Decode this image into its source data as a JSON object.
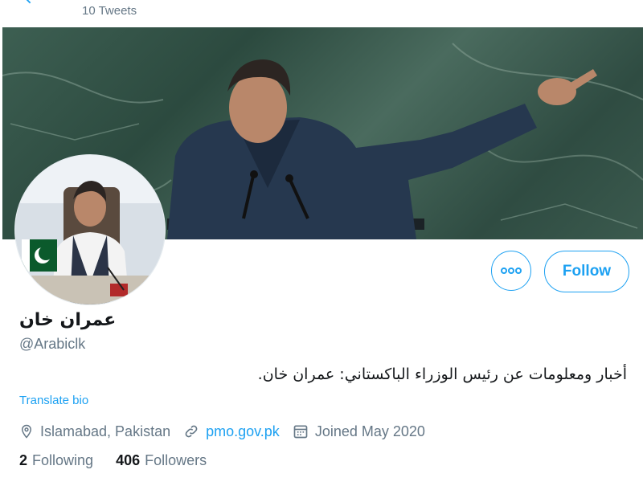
{
  "header": {
    "tweets_count": "10 Tweets"
  },
  "profile": {
    "display_name": "عمران خان",
    "handle": "@Arabiclk",
    "bio": "أخبار ومعلومات عن رئيس الوزراء الباكستاني: عمران خان.",
    "translate_label": "Translate bio",
    "location": "Islamabad, Pakistan",
    "website": "pmo.gov.pk",
    "joined": "Joined May 2020"
  },
  "stats": {
    "following_count": "2",
    "following_label": "Following",
    "followers_count": "406",
    "followers_label": "Followers"
  },
  "actions": {
    "follow_label": "Follow"
  },
  "icons": {
    "back": "arrow-left-icon",
    "more": "more-dots-icon",
    "location": "location-pin-icon",
    "link": "link-icon",
    "calendar": "calendar-icon"
  },
  "colors": {
    "accent": "#1da1f2",
    "secondary_text": "#657786"
  }
}
